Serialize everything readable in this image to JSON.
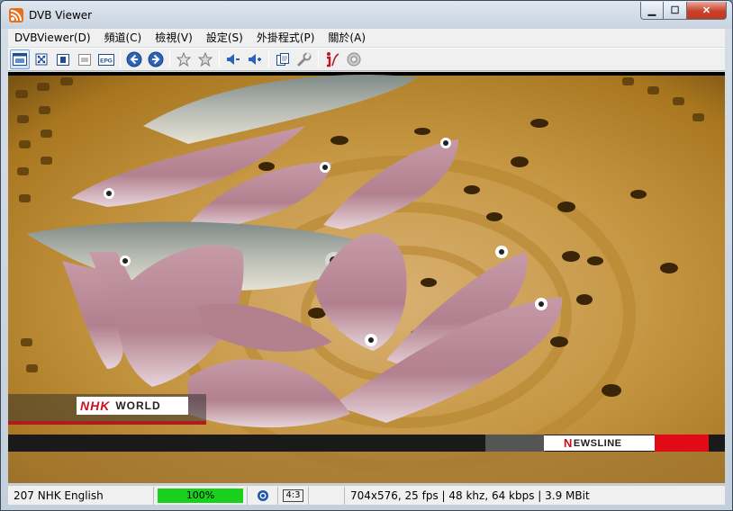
{
  "window": {
    "title": "DVB Viewer",
    "app_icon": "rss-broadcast-icon",
    "controls": {
      "minimize": "▁",
      "maximize": "☐",
      "close": "✕"
    }
  },
  "menu": {
    "items": [
      {
        "label": "DVBViewer(D)"
      },
      {
        "label": "頻道(C)"
      },
      {
        "label": "檢視(V)"
      },
      {
        "label": "設定(S)"
      },
      {
        "label": "外掛程式(P)"
      },
      {
        "label": "關於(A)"
      }
    ]
  },
  "toolbar": {
    "buttons": [
      {
        "icon": "window-mode-icon"
      },
      {
        "icon": "fullscreen-icon"
      },
      {
        "icon": "teletext-icon"
      },
      {
        "icon": "osd-icon"
      },
      {
        "icon": "epg-icon",
        "text": "EPG"
      },
      {
        "icon": "arrow-left-icon"
      },
      {
        "icon": "arrow-right-icon"
      },
      {
        "icon": "star-icon"
      },
      {
        "icon": "star-outline-icon"
      },
      {
        "icon": "volume-down-icon"
      },
      {
        "icon": "volume-up-icon"
      },
      {
        "icon": "copy-icon"
      },
      {
        "icon": "wrench-icon"
      },
      {
        "icon": "info-icon"
      },
      {
        "icon": "disc-icon"
      }
    ]
  },
  "video": {
    "logo_nhk": "NHK",
    "logo_world": "WORLD",
    "newsline_first": "N",
    "newsline_rest": "EWSLINE"
  },
  "status": {
    "channel": "207 NHK English",
    "signal_text": "100%",
    "signal_level": 1.0,
    "aspect": "4:3",
    "info": "704x576, 25 fps | 48 khz, 64 kbps | 3.9 MBit"
  },
  "colors": {
    "signal_green": "#19d11d",
    "nhk_red": "#d10d1d",
    "close_red": "#c9402a"
  }
}
